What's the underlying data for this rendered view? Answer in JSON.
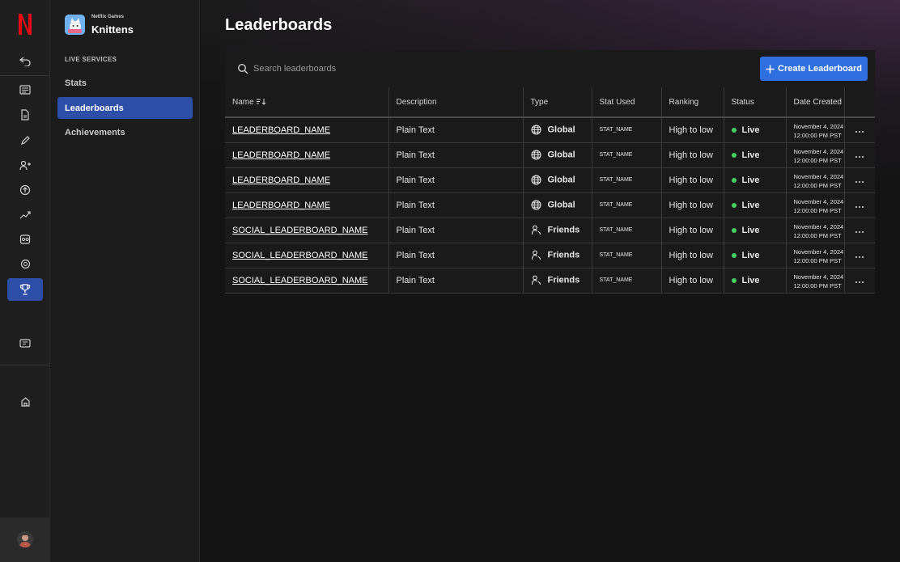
{
  "rail": {
    "items": [
      {
        "icon": "back-icon"
      },
      {
        "icon": "news-icon"
      },
      {
        "icon": "document-icon"
      },
      {
        "icon": "pencil-icon"
      },
      {
        "icon": "users-icon"
      },
      {
        "icon": "upload-icon"
      },
      {
        "icon": "trend-icon"
      },
      {
        "icon": "gamepad-icon"
      },
      {
        "icon": "badge-icon"
      },
      {
        "icon": "trophy-icon"
      },
      {
        "icon": "chat-icon"
      },
      {
        "icon": "home-icon"
      }
    ]
  },
  "sidebar": {
    "studio": "Netflix Games",
    "app_name": "Knittens",
    "section": "LIVE SERVICES",
    "items": [
      {
        "label": "Stats"
      },
      {
        "label": "Leaderboards"
      },
      {
        "label": "Achievements"
      }
    ]
  },
  "main": {
    "title": "Leaderboards",
    "search_placeholder": "Search leaderboards",
    "create_label": "Create Leaderboard",
    "columns": [
      "Name",
      "Description",
      "Type",
      "Stat Used",
      "Ranking",
      "Status",
      "Date Created"
    ],
    "rows": [
      {
        "name": "LEADERBOARD_NAME",
        "description": "Plain Text",
        "type": "Global",
        "type_icon": "globe-icon",
        "stat": "STAT_NAME",
        "ranking": "High to low",
        "status": "Live",
        "date1": "November 4, 2024",
        "date2": "12:00:00 PM PST"
      },
      {
        "name": "LEADERBOARD_NAME",
        "description": "Plain Text",
        "type": "Global",
        "type_icon": "globe-icon",
        "stat": "STAT_NAME",
        "ranking": "High to low",
        "status": "Live",
        "date1": "November 4, 2024",
        "date2": "12:00:00 PM PST"
      },
      {
        "name": "LEADERBOARD_NAME",
        "description": "Plain Text",
        "type": "Global",
        "type_icon": "globe-icon",
        "stat": "STAT_NAME",
        "ranking": "High to low",
        "status": "Live",
        "date1": "November 4, 2024",
        "date2": "12:00:00 PM PST"
      },
      {
        "name": "LEADERBOARD_NAME",
        "description": "Plain Text",
        "type": "Global",
        "type_icon": "globe-icon",
        "stat": "STAT_NAME",
        "ranking": "High to low",
        "status": "Live",
        "date1": "November 4, 2024",
        "date2": "12:00:00 PM PST"
      },
      {
        "name": "SOCIAL_LEADERBOARD_NAME",
        "description": "Plain Text",
        "type": "Friends",
        "type_icon": "friends-icon",
        "stat": "STAT_NAME",
        "ranking": "High to low",
        "status": "Live",
        "date1": "November 4, 2024",
        "date2": "12:00:00 PM PST"
      },
      {
        "name": "SOCIAL_LEADERBOARD_NAME",
        "description": "Plain Text",
        "type": "Friends",
        "type_icon": "friends-icon",
        "stat": "STAT_NAME",
        "ranking": "High to low",
        "status": "Live",
        "date1": "November 4, 2024",
        "date2": "12:00:00 PM PST"
      },
      {
        "name": "SOCIAL_LEADERBOARD_NAME",
        "description": "Plain Text",
        "type": "Friends",
        "type_icon": "friends-icon",
        "stat": "STAT_NAME",
        "ranking": "High to low",
        "status": "Live",
        "date1": "November 4, 2024",
        "date2": "12:00:00 PM PST"
      }
    ]
  },
  "colors": {
    "accent": "#2f6fe0",
    "active_nav": "#2e4fa8",
    "live": "#46d160",
    "brand": "#e50914"
  }
}
